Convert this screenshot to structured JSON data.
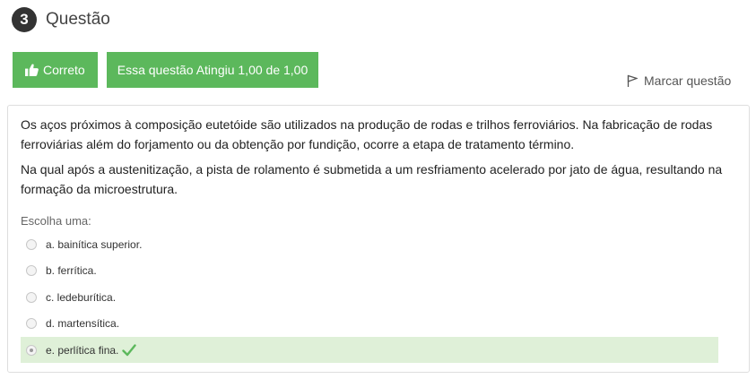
{
  "question": {
    "number": "3",
    "title": "Questão"
  },
  "status": {
    "correct_label": "Correto",
    "grade_label": "Essa questão Atingiu 1,00 de 1,00",
    "color": "#5cb85c"
  },
  "flag": {
    "label": "Marcar questão"
  },
  "body": {
    "paragraph1": "Os aços próximos à composição eutetóide são utilizados na produção de rodas e trilhos ferroviários. Na fabricação de rodas ferroviárias além do forjamento ou da obtenção por fundição, ocorre a etapa de tratamento término.",
    "paragraph2": "Na qual após a austenitização, a pista de rolamento é submetida a um resfriamento acelerado por jato de água, resultando na formação da microestrutura."
  },
  "answer": {
    "prompt": "Escolha uma:",
    "options": [
      {
        "label": "a. bainítica superior.",
        "selected": false
      },
      {
        "label": "b. ferrítica.",
        "selected": false
      },
      {
        "label": "c. ledeburítica.",
        "selected": false
      },
      {
        "label": "d. martensítica.",
        "selected": false
      },
      {
        "label": "e. perlítica fina.",
        "selected": true,
        "correct": true
      }
    ],
    "selected_bg": "#dff0d8",
    "check_color": "#5cb85c"
  }
}
